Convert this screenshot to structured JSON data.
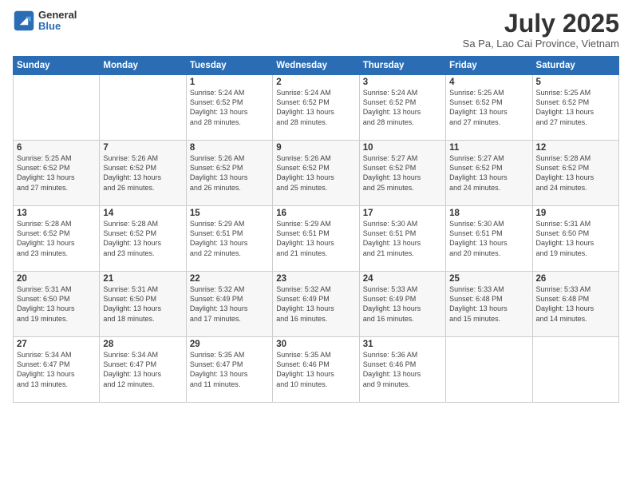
{
  "header": {
    "logo_general": "General",
    "logo_blue": "Blue",
    "month_title": "July 2025",
    "location": "Sa Pa, Lao Cai Province, Vietnam"
  },
  "days_of_week": [
    "Sunday",
    "Monday",
    "Tuesday",
    "Wednesday",
    "Thursday",
    "Friday",
    "Saturday"
  ],
  "weeks": [
    [
      {
        "day": "",
        "info": ""
      },
      {
        "day": "",
        "info": ""
      },
      {
        "day": "1",
        "info": "Sunrise: 5:24 AM\nSunset: 6:52 PM\nDaylight: 13 hours\nand 28 minutes."
      },
      {
        "day": "2",
        "info": "Sunrise: 5:24 AM\nSunset: 6:52 PM\nDaylight: 13 hours\nand 28 minutes."
      },
      {
        "day": "3",
        "info": "Sunrise: 5:24 AM\nSunset: 6:52 PM\nDaylight: 13 hours\nand 28 minutes."
      },
      {
        "day": "4",
        "info": "Sunrise: 5:25 AM\nSunset: 6:52 PM\nDaylight: 13 hours\nand 27 minutes."
      },
      {
        "day": "5",
        "info": "Sunrise: 5:25 AM\nSunset: 6:52 PM\nDaylight: 13 hours\nand 27 minutes."
      }
    ],
    [
      {
        "day": "6",
        "info": "Sunrise: 5:25 AM\nSunset: 6:52 PM\nDaylight: 13 hours\nand 27 minutes."
      },
      {
        "day": "7",
        "info": "Sunrise: 5:26 AM\nSunset: 6:52 PM\nDaylight: 13 hours\nand 26 minutes."
      },
      {
        "day": "8",
        "info": "Sunrise: 5:26 AM\nSunset: 6:52 PM\nDaylight: 13 hours\nand 26 minutes."
      },
      {
        "day": "9",
        "info": "Sunrise: 5:26 AM\nSunset: 6:52 PM\nDaylight: 13 hours\nand 25 minutes."
      },
      {
        "day": "10",
        "info": "Sunrise: 5:27 AM\nSunset: 6:52 PM\nDaylight: 13 hours\nand 25 minutes."
      },
      {
        "day": "11",
        "info": "Sunrise: 5:27 AM\nSunset: 6:52 PM\nDaylight: 13 hours\nand 24 minutes."
      },
      {
        "day": "12",
        "info": "Sunrise: 5:28 AM\nSunset: 6:52 PM\nDaylight: 13 hours\nand 24 minutes."
      }
    ],
    [
      {
        "day": "13",
        "info": "Sunrise: 5:28 AM\nSunset: 6:52 PM\nDaylight: 13 hours\nand 23 minutes."
      },
      {
        "day": "14",
        "info": "Sunrise: 5:28 AM\nSunset: 6:52 PM\nDaylight: 13 hours\nand 23 minutes."
      },
      {
        "day": "15",
        "info": "Sunrise: 5:29 AM\nSunset: 6:51 PM\nDaylight: 13 hours\nand 22 minutes."
      },
      {
        "day": "16",
        "info": "Sunrise: 5:29 AM\nSunset: 6:51 PM\nDaylight: 13 hours\nand 21 minutes."
      },
      {
        "day": "17",
        "info": "Sunrise: 5:30 AM\nSunset: 6:51 PM\nDaylight: 13 hours\nand 21 minutes."
      },
      {
        "day": "18",
        "info": "Sunrise: 5:30 AM\nSunset: 6:51 PM\nDaylight: 13 hours\nand 20 minutes."
      },
      {
        "day": "19",
        "info": "Sunrise: 5:31 AM\nSunset: 6:50 PM\nDaylight: 13 hours\nand 19 minutes."
      }
    ],
    [
      {
        "day": "20",
        "info": "Sunrise: 5:31 AM\nSunset: 6:50 PM\nDaylight: 13 hours\nand 19 minutes."
      },
      {
        "day": "21",
        "info": "Sunrise: 5:31 AM\nSunset: 6:50 PM\nDaylight: 13 hours\nand 18 minutes."
      },
      {
        "day": "22",
        "info": "Sunrise: 5:32 AM\nSunset: 6:49 PM\nDaylight: 13 hours\nand 17 minutes."
      },
      {
        "day": "23",
        "info": "Sunrise: 5:32 AM\nSunset: 6:49 PM\nDaylight: 13 hours\nand 16 minutes."
      },
      {
        "day": "24",
        "info": "Sunrise: 5:33 AM\nSunset: 6:49 PM\nDaylight: 13 hours\nand 16 minutes."
      },
      {
        "day": "25",
        "info": "Sunrise: 5:33 AM\nSunset: 6:48 PM\nDaylight: 13 hours\nand 15 minutes."
      },
      {
        "day": "26",
        "info": "Sunrise: 5:33 AM\nSunset: 6:48 PM\nDaylight: 13 hours\nand 14 minutes."
      }
    ],
    [
      {
        "day": "27",
        "info": "Sunrise: 5:34 AM\nSunset: 6:47 PM\nDaylight: 13 hours\nand 13 minutes."
      },
      {
        "day": "28",
        "info": "Sunrise: 5:34 AM\nSunset: 6:47 PM\nDaylight: 13 hours\nand 12 minutes."
      },
      {
        "day": "29",
        "info": "Sunrise: 5:35 AM\nSunset: 6:47 PM\nDaylight: 13 hours\nand 11 minutes."
      },
      {
        "day": "30",
        "info": "Sunrise: 5:35 AM\nSunset: 6:46 PM\nDaylight: 13 hours\nand 10 minutes."
      },
      {
        "day": "31",
        "info": "Sunrise: 5:36 AM\nSunset: 6:46 PM\nDaylight: 13 hours\nand 9 minutes."
      },
      {
        "day": "",
        "info": ""
      },
      {
        "day": "",
        "info": ""
      }
    ]
  ]
}
